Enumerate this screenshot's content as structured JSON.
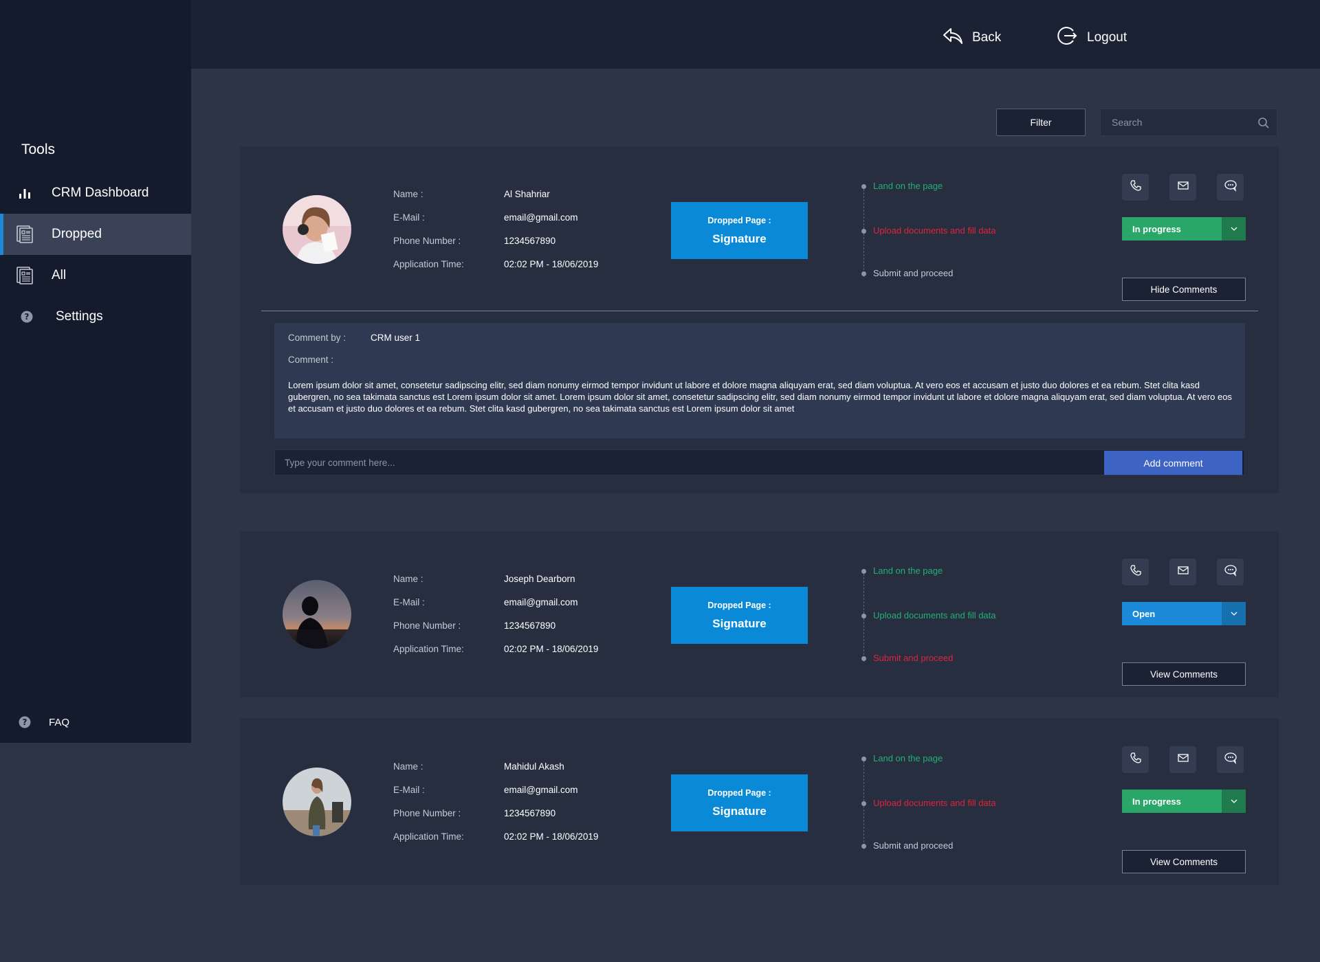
{
  "sidebar": {
    "section_title": "Tools",
    "items": [
      {
        "label": "CRM Dashboard",
        "icon": "bar-chart-icon"
      },
      {
        "label": "Dropped",
        "icon": "document-list-icon"
      },
      {
        "label": "All",
        "icon": "document-list-icon"
      },
      {
        "label": "Settings",
        "icon": "question-icon"
      }
    ],
    "faq_label": "FAQ"
  },
  "header": {
    "back_label": "Back",
    "logout_label": "Logout"
  },
  "toolbar": {
    "filter_label": "Filter",
    "search_placeholder": "Search"
  },
  "labels": {
    "name": "Name :",
    "email": "E-Mail :",
    "phone": "Phone Number :",
    "app_time": "Application Time:",
    "dropped_page": "Dropped Page :"
  },
  "records": [
    {
      "name": "Al Shahriar",
      "email": "email@gmail.com",
      "phone": "1234567890",
      "app_time": "02:02 PM - 18/06/2019",
      "dropped_page": "Signature",
      "steps": [
        "Land on the page",
        "Upload documents and fill data",
        "Submit and proceed"
      ],
      "status": "In progress",
      "comments_button": "Hide Comments"
    },
    {
      "name": "Joseph Dearborn",
      "email": "email@gmail.com",
      "phone": "1234567890",
      "app_time": "02:02 PM - 18/06/2019",
      "dropped_page": "Signature",
      "steps": [
        "Land on the page",
        "Upload documents and fill data",
        "Submit and proceed"
      ],
      "status": "Open",
      "comments_button": "View Comments"
    },
    {
      "name": "Mahidul Akash",
      "email": "email@gmail.com",
      "phone": "1234567890",
      "app_time": "02:02 PM - 18/06/2019",
      "dropped_page": "Signature",
      "steps": [
        "Land on the page",
        "Upload documents and fill data",
        "Submit and proceed"
      ],
      "status": "In progress",
      "comments_button": "View Comments"
    }
  ],
  "comment": {
    "by_label": "Comment by :",
    "by_value": "CRM user 1",
    "comment_label": "Comment :",
    "text": "Lorem ipsum dolor sit amet, consetetur sadipscing elitr, sed diam nonumy eirmod tempor invidunt ut labore et dolore magna aliquyam erat, sed diam voluptua. At vero eos et accusam et justo duo dolores et ea rebum. Stet clita kasd gubergren, no sea takimata sanctus est Lorem ipsum dolor sit amet. Lorem ipsum dolor sit amet, consetetur sadipscing elitr, sed diam nonumy eirmod tempor invidunt ut labore et dolore magna aliquyam erat, sed diam voluptua. At vero eos et accusam et justo duo dolores et ea rebum. Stet clita kasd gubergren, no sea takimata sanctus est Lorem ipsum dolor sit amet",
    "input_placeholder": "Type your comment here...",
    "add_button": "Add comment"
  },
  "colors": {
    "step_done": "#27ae72",
    "step_dropped": "#e0243b",
    "step_pending": "#c6cad3",
    "accent": "#0a8ad6"
  }
}
